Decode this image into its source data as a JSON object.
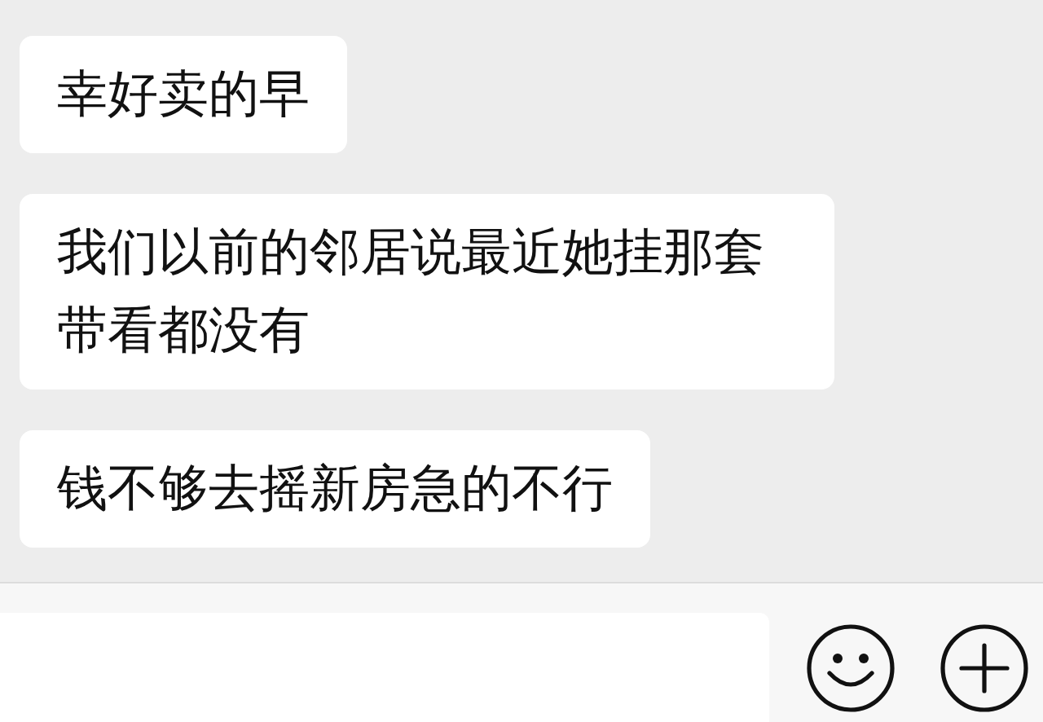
{
  "messages": [
    {
      "text": "幸好卖的早"
    },
    {
      "text": "我们以前的邻居说最近她挂那套带看都没有"
    },
    {
      "text": "钱不够去摇新房急的不行"
    }
  ]
}
